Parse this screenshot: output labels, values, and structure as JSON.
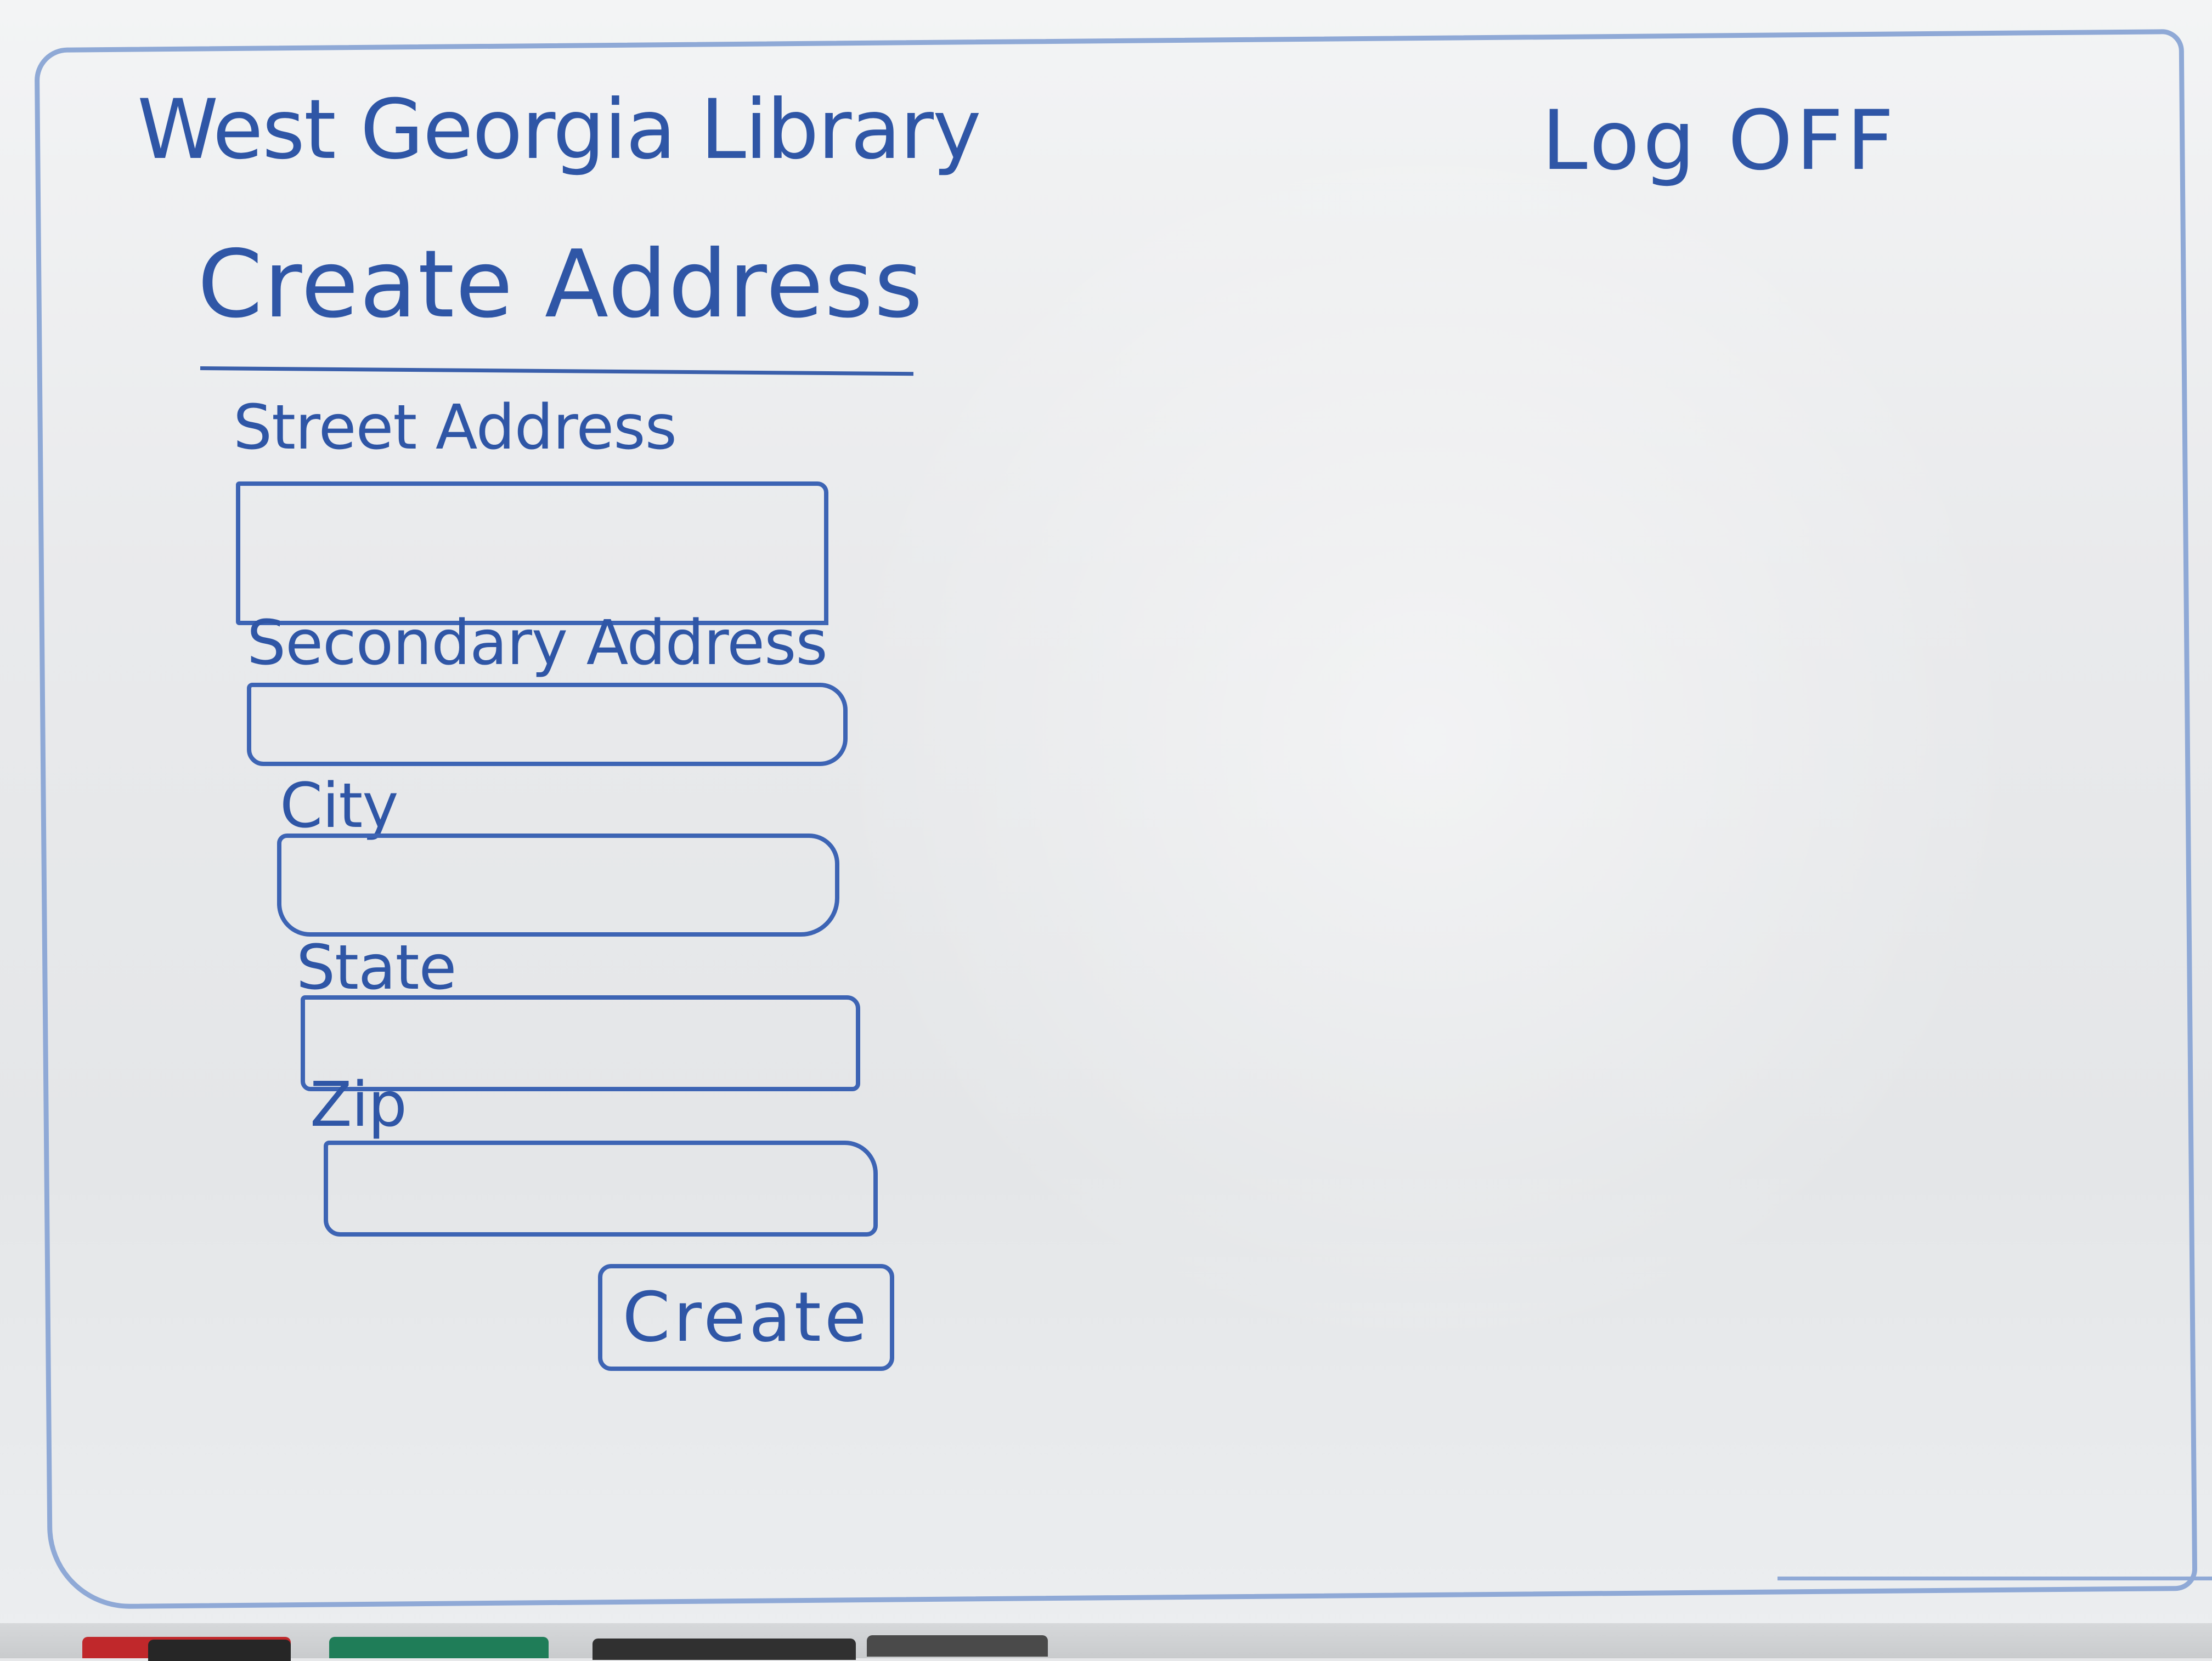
{
  "header": {
    "app_title": "West Georgia Library",
    "logoff_label": "Log OFF"
  },
  "page": {
    "title": "Create Address"
  },
  "form": {
    "fields": [
      {
        "label": "Street Address",
        "value": ""
      },
      {
        "label": "Secondary Address",
        "value": ""
      },
      {
        "label": "City",
        "value": ""
      },
      {
        "label": "State",
        "value": ""
      },
      {
        "label": "Zip",
        "value": ""
      }
    ],
    "submit_label": "Create"
  },
  "colors": {
    "ink": "#2f56a6",
    "board": "#e9eaec"
  },
  "markers": [
    {
      "name": "red-marker",
      "color": "#c0282b"
    },
    {
      "name": "black-marker",
      "color": "#262626"
    },
    {
      "name": "green-marker",
      "color": "#1f7d58"
    },
    {
      "name": "black-marker-2",
      "color": "#303030"
    },
    {
      "name": "eraser",
      "color": "#4a4a4a"
    }
  ]
}
